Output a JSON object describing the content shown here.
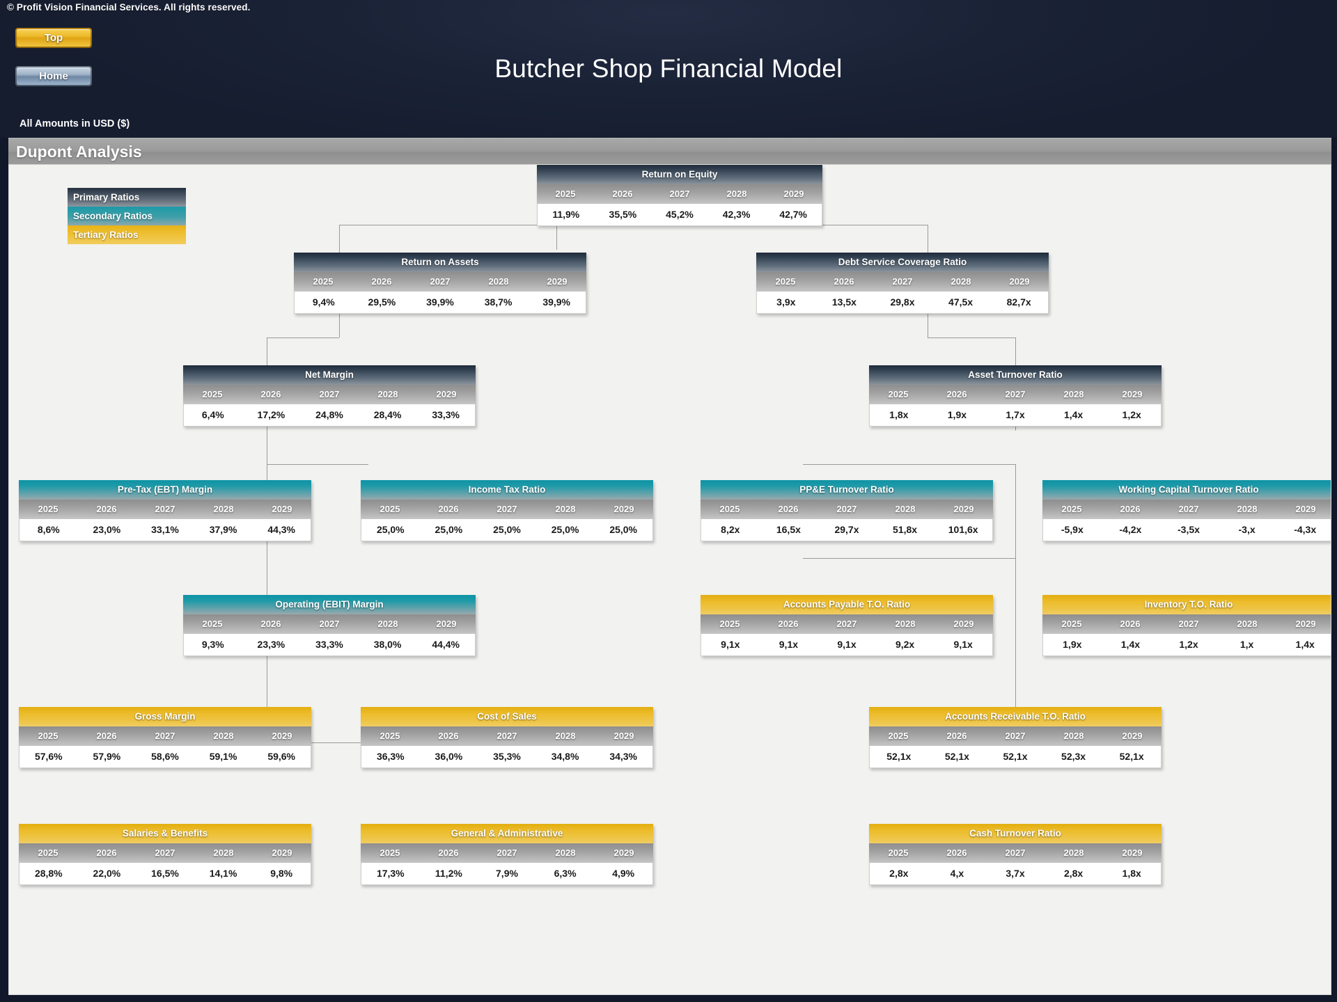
{
  "header": {
    "copyright": "© Profit Vision Financial Services. All rights reserved.",
    "title": "Butcher Shop Financial Model",
    "amounts_note": "All Amounts in  USD ($)",
    "buttons": {
      "top": "Top",
      "home": "Home"
    }
  },
  "section": {
    "title": "Dupont Analysis"
  },
  "legend": {
    "primary": "Primary Ratios",
    "secondary": "Secondary Ratios",
    "tertiary": "Tertiary Ratios",
    "colors": {
      "primary": "#24303f",
      "secondary": "#1c9aa8",
      "tertiary": "#e8b317"
    }
  },
  "years": [
    "2025",
    "2026",
    "2027",
    "2028",
    "2029"
  ],
  "chart_data": {
    "type": "diagram-tree",
    "title": "Dupont Analysis",
    "categories": [
      "2025",
      "2026",
      "2027",
      "2028",
      "2029"
    ],
    "nodes": [
      {
        "id": "roe",
        "label": "Return on Equity",
        "tier": "primary",
        "values": [
          "11,9%",
          "35,5%",
          "45,2%",
          "42,3%",
          "42,7%"
        ]
      },
      {
        "id": "roa",
        "label": "Return on Assets",
        "tier": "primary",
        "values": [
          "9,4%",
          "29,5%",
          "39,9%",
          "38,7%",
          "39,9%"
        ]
      },
      {
        "id": "dscr",
        "label": "Debt Service Coverage Ratio",
        "tier": "primary",
        "values": [
          "3,9x",
          "13,5x",
          "29,8x",
          "47,5x",
          "82,7x"
        ]
      },
      {
        "id": "nm",
        "label": "Net Margin",
        "tier": "primary",
        "values": [
          "6,4%",
          "17,2%",
          "24,8%",
          "28,4%",
          "33,3%"
        ]
      },
      {
        "id": "ator",
        "label": "Asset Turnover Ratio",
        "tier": "primary",
        "values": [
          "1,8x",
          "1,9x",
          "1,7x",
          "1,4x",
          "1,2x"
        ]
      },
      {
        "id": "ebt",
        "label": "Pre-Tax (EBT) Margin",
        "tier": "secondary",
        "values": [
          "8,6%",
          "23,0%",
          "33,1%",
          "37,9%",
          "44,3%"
        ]
      },
      {
        "id": "itr",
        "label": "Income Tax Ratio",
        "tier": "secondary",
        "values": [
          "25,0%",
          "25,0%",
          "25,0%",
          "25,0%",
          "25,0%"
        ]
      },
      {
        "id": "ppe",
        "label": "PP&E Turnover Ratio",
        "tier": "secondary",
        "values": [
          "8,2x",
          "16,5x",
          "29,7x",
          "51,8x",
          "101,6x"
        ]
      },
      {
        "id": "wctr",
        "label": "Working Capital Turnover Ratio",
        "tier": "secondary",
        "values": [
          "-5,9x",
          "-4,2x",
          "-3,5x",
          "-3,x",
          "-4,3x"
        ]
      },
      {
        "id": "ebit",
        "label": "Operating (EBIT) Margin",
        "tier": "secondary",
        "values": [
          "9,3%",
          "23,3%",
          "33,3%",
          "38,0%",
          "44,4%"
        ]
      },
      {
        "id": "ap",
        "label": "Accounts Payable T.O. Ratio",
        "tier": "tertiary",
        "values": [
          "9,1x",
          "9,1x",
          "9,1x",
          "9,2x",
          "9,1x"
        ]
      },
      {
        "id": "inv",
        "label": "Inventory T.O. Ratio",
        "tier": "tertiary",
        "values": [
          "1,9x",
          "1,4x",
          "1,2x",
          "1,x",
          "1,4x"
        ]
      },
      {
        "id": "gm",
        "label": "Gross  Margin",
        "tier": "tertiary",
        "values": [
          "57,6%",
          "57,9%",
          "58,6%",
          "59,1%",
          "59,6%"
        ]
      },
      {
        "id": "cos",
        "label": "Cost of Sales",
        "tier": "tertiary",
        "values": [
          "36,3%",
          "36,0%",
          "35,3%",
          "34,8%",
          "34,3%"
        ]
      },
      {
        "id": "ar",
        "label": "Accounts Receivable T.O. Ratio",
        "tier": "tertiary",
        "values": [
          "52,1x",
          "52,1x",
          "52,1x",
          "52,3x",
          "52,1x"
        ]
      },
      {
        "id": "sb",
        "label": "Salaries & Benefits",
        "tier": "tertiary",
        "values": [
          "28,8%",
          "22,0%",
          "16,5%",
          "14,1%",
          "9,8%"
        ]
      },
      {
        "id": "ga",
        "label": "General & Administrative",
        "tier": "tertiary",
        "values": [
          "17,3%",
          "11,2%",
          "7,9%",
          "6,3%",
          "4,9%"
        ]
      },
      {
        "id": "cash",
        "label": "Cash Turnover Ratio",
        "tier": "tertiary",
        "values": [
          "2,8x",
          "4,x",
          "3,7x",
          "2,8x",
          "1,8x"
        ]
      }
    ]
  }
}
